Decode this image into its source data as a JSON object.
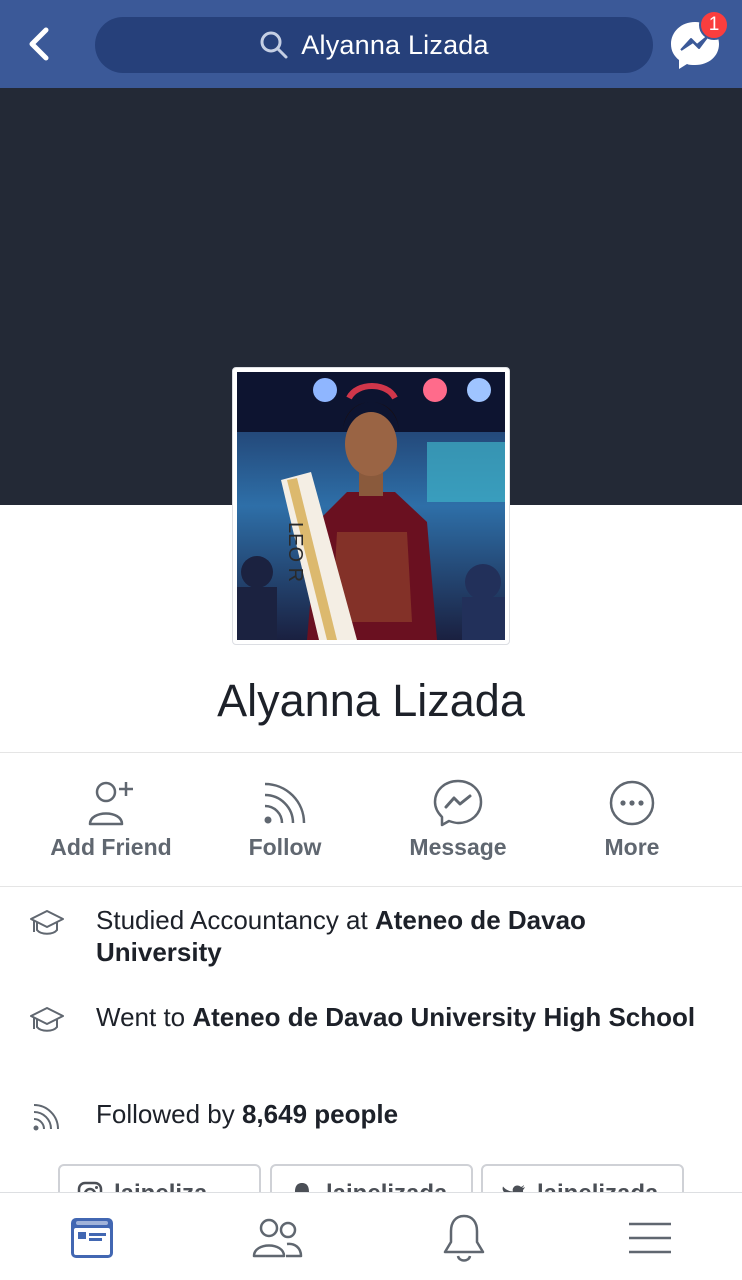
{
  "header": {
    "search_query": "Alyanna Lizada",
    "messenger_badge": "1"
  },
  "profile": {
    "name": "Alyanna Lizada",
    "photo_sash_text": "LEO R"
  },
  "actions": [
    {
      "label": "Add Friend",
      "icon": "add-friend-icon"
    },
    {
      "label": "Follow",
      "icon": "follow-icon"
    },
    {
      "label": "Message",
      "icon": "messenger-icon"
    },
    {
      "label": "More",
      "icon": "more-icon"
    }
  ],
  "about": {
    "education_1": {
      "prefix": "Studied Accountancy at ",
      "school": "Ateneo de Davao University"
    },
    "education_2": {
      "prefix": "Went to ",
      "school": "Ateneo de Davao University High School"
    },
    "followers": {
      "prefix": "Followed by ",
      "count": "8,649 people"
    }
  },
  "social": [
    {
      "platform": "instagram-icon",
      "handle": "laineliza"
    },
    {
      "platform": "snapchat-icon",
      "handle": "lainelizada"
    },
    {
      "platform": "twitter-icon",
      "handle": "lainelizada"
    }
  ],
  "tabbar": [
    "news-feed-icon",
    "friends-icon",
    "notifications-icon",
    "menu-icon"
  ],
  "colors": {
    "brand": "#3b5998",
    "search_bg": "#26407a",
    "cover": "#232936",
    "badge": "#fa3e3e",
    "active_tab": "#4267b2",
    "icon_gray": "#606770"
  }
}
